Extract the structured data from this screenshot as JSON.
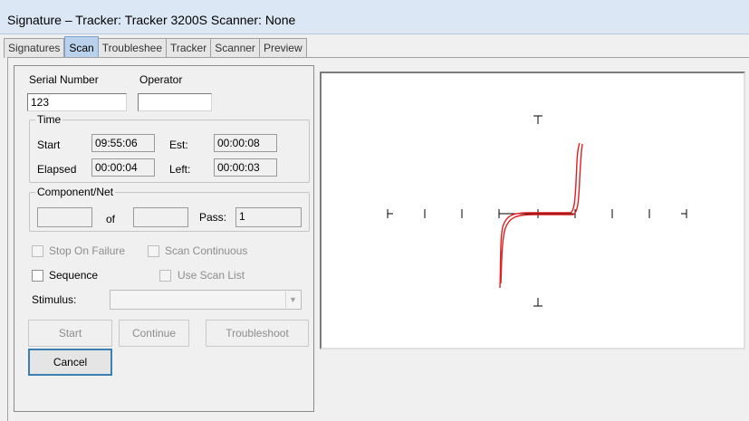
{
  "window": {
    "title": "Signature – Tracker: Tracker 3200S  Scanner: None"
  },
  "tabs": [
    {
      "label": "Signatures",
      "active": false
    },
    {
      "label": "Scan",
      "active": true
    },
    {
      "label": "Troubleshee",
      "active": false
    },
    {
      "label": "Tracker",
      "active": false
    },
    {
      "label": "Scanner",
      "active": false
    },
    {
      "label": "Preview",
      "active": false
    }
  ],
  "form": {
    "serial_number_label": "Serial Number",
    "serial_number_value": "123",
    "operator_label": "Operator",
    "operator_value": "",
    "time": {
      "legend": "Time",
      "start_label": "Start",
      "start_value": "09:55:06",
      "est_label": "Est:",
      "est_value": "00:00:08",
      "elapsed_label": "Elapsed",
      "elapsed_value": "00:00:04",
      "left_label": "Left:",
      "left_value": "00:00:03"
    },
    "component_net": {
      "legend": "Component/Net",
      "current_value": "",
      "of_label": "of",
      "total_value": "",
      "pass_label": "Pass:",
      "pass_value": "1"
    },
    "options": {
      "stop_on_failure": {
        "label": "Stop On Failure",
        "checked": false,
        "enabled": false
      },
      "scan_continuous": {
        "label": "Scan Continuous",
        "checked": false,
        "enabled": false
      },
      "sequence": {
        "label": "Sequence",
        "checked": false,
        "enabled": true
      },
      "use_scan_list": {
        "label": "Use Scan List",
        "checked": false,
        "enabled": false
      }
    },
    "stimulus_label": "Stimulus:",
    "stimulus_value": ""
  },
  "buttons": {
    "start": "Start",
    "continue": "Continue",
    "troubleshoot": "Troubleshoot",
    "cancel": "Cancel"
  },
  "plot": {
    "trace_color": "#e02020",
    "axis_color": "#000000"
  }
}
